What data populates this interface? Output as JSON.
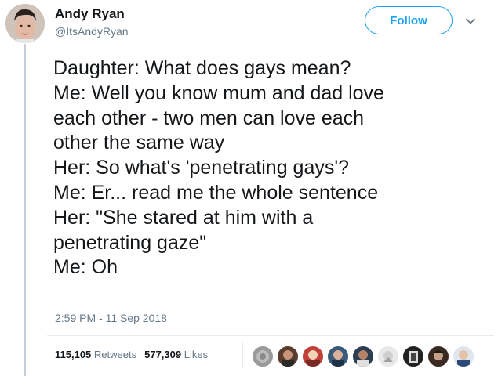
{
  "author": {
    "display_name": "Andy Ryan",
    "handle": "@ItsAndyRyan"
  },
  "follow_label": "Follow",
  "tweet_lines": [
    "Daughter: What does gays mean?",
    "Me: Well you know mum and dad love",
    "each other - two men can love each",
    "other the same way",
    "Her: So what's 'penetrating gays'?",
    "Me: Er... read me the whole sentence",
    "Her: \"She stared at him with a",
    "penetrating gaze\"",
    "Me: Oh"
  ],
  "timestamp": "2:59 PM - 11 Sep 2018",
  "stats": {
    "retweets_count": "115,105",
    "retweets_label": "Retweets",
    "likes_count": "577,309",
    "likes_label": "Likes"
  },
  "colors": {
    "accent": "#1da1f2",
    "secondary_text": "#657786",
    "thread_line": "#c4cfd6"
  },
  "icons": {
    "caret": "chevron-down-icon"
  }
}
